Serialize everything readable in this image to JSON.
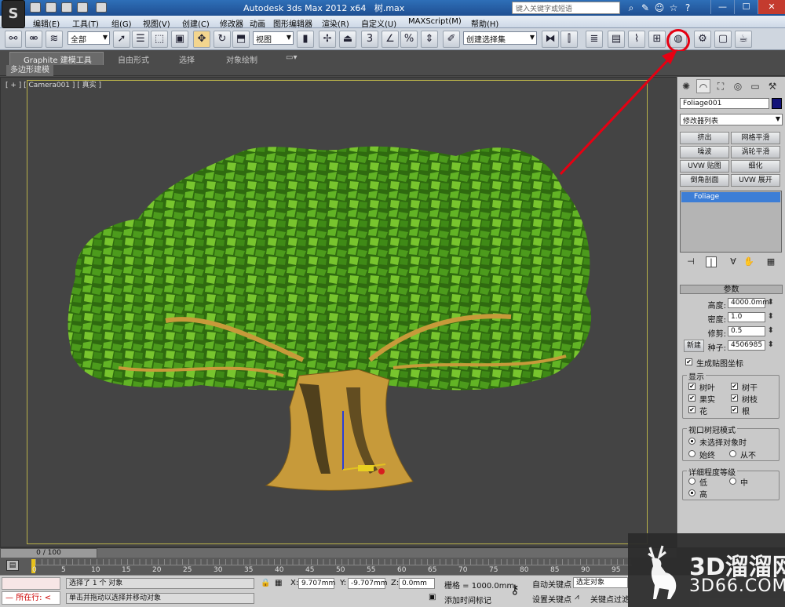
{
  "app": {
    "title": "Autodesk 3ds Max  2012 x64",
    "filename": "树.max",
    "logo": "S",
    "search_placeholder": "键入关键字或短语"
  },
  "menu": [
    "编辑(E)",
    "工具(T)",
    "组(G)",
    "视图(V)",
    "创建(C)",
    "修改器",
    "动画",
    "图形编辑器",
    "渲染(R)",
    "自定义(U)",
    "MAXScript(M)",
    "帮助(H)"
  ],
  "toolbar": {
    "selection_filter": "全部",
    "ref_coord": "视图",
    "named_selection": "创建选择集",
    "highlight_color": "#e60012"
  },
  "ribbon": {
    "tabs": [
      "Graphite 建模工具",
      "自由形式",
      "选择",
      "对象绘制"
    ],
    "sub_tab": "多边形建模"
  },
  "viewport": {
    "label": "[ + ] [ Camera001 ] [ 真实 ]",
    "background": "#444444",
    "foliage_color": "#4c9b1c",
    "trunk_color": "#c79a3a"
  },
  "command_panel": {
    "object_name": "Foliage001",
    "object_color": "#121278",
    "modifier_list": "修改器列表",
    "modifier_buttons": [
      "挤出",
      "网格平滑",
      "噪波",
      "涡轮平滑",
      "UVW 贴图",
      "细化",
      "倒角剖面",
      "UVW 展开"
    ],
    "stack_item": "Foliage",
    "rollup_title": "参数",
    "params": {
      "height_label": "高度:",
      "height_value": "4000.0mm",
      "density_label": "密度:",
      "density_value": "1.0",
      "prune_label": "修剪:",
      "prune_value": "0.5",
      "new_button": "新建",
      "seed_label": "种子:",
      "seed_value": "4506985",
      "gen_map_label": "生成贴图坐标"
    },
    "display": {
      "title": "显示",
      "items": [
        "树叶",
        "树干",
        "果实",
        "树枝",
        "花",
        "根"
      ]
    },
    "canopy": {
      "title": "视口树冠模式",
      "options": [
        "未选择对象时",
        "始终",
        "从不"
      ]
    },
    "lod": {
      "title": "详细程度等级",
      "options": [
        "低",
        "中",
        "高"
      ]
    }
  },
  "timeline": {
    "frame": "0 / 100",
    "ticks": [
      "0",
      "5",
      "10",
      "15",
      "20",
      "25",
      "30",
      "35",
      "40",
      "45",
      "50",
      "55",
      "60",
      "65",
      "70",
      "75",
      "80",
      "85",
      "90",
      "95"
    ]
  },
  "status": {
    "location": "所在行:",
    "selected": "选择了 1 个 对象",
    "prompt": "单击并拖动以选择并移动对象",
    "x_label": "X:",
    "x_value": "9.707mm",
    "y_label": "Y:",
    "y_value": "-9.707mm",
    "z_label": "Z:",
    "z_value": "0.0mm",
    "grid": "栅格 = 1000.0mm",
    "add_time_tag": "添加时间标记",
    "auto_key": "自动关键点",
    "selected_obj": "选定对象",
    "set_key": "设置关键点",
    "key_filter": "关键点过滤"
  },
  "watermark": {
    "main": "3D溜溜网",
    "sub": "3D66.COM"
  }
}
